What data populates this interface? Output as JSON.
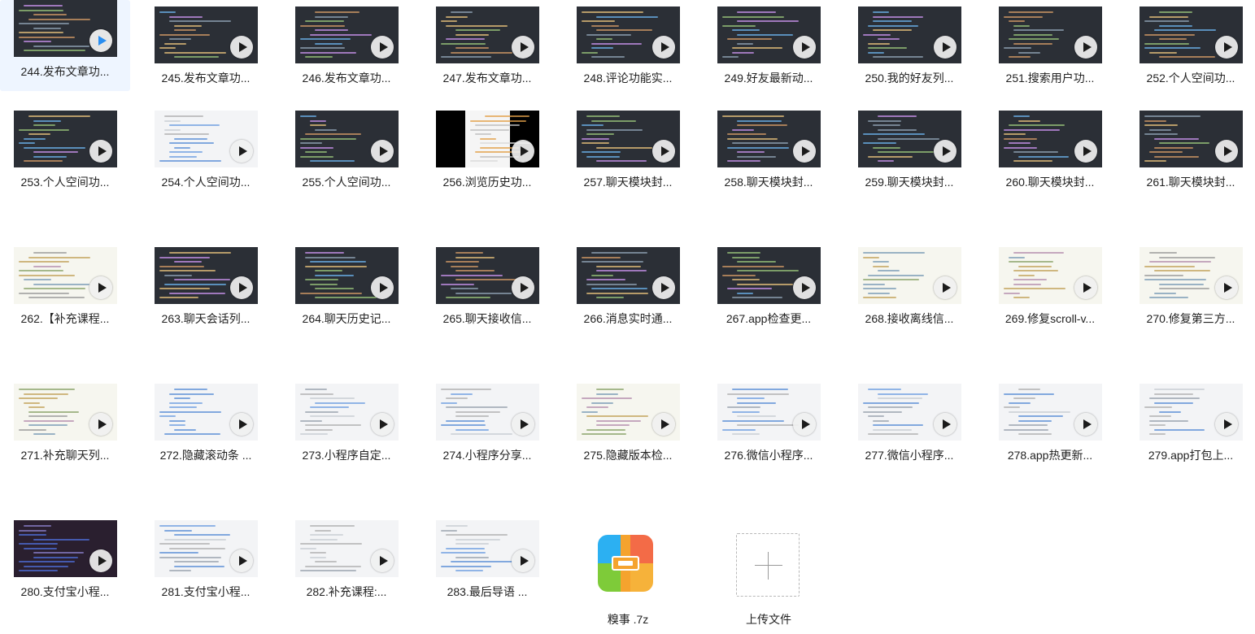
{
  "files": [
    {
      "name": "244.发布文章功...",
      "theme": "dark",
      "selected": true
    },
    {
      "name": "245.发布文章功...",
      "theme": "dark"
    },
    {
      "name": "246.发布文章功...",
      "theme": "dark"
    },
    {
      "name": "247.发布文章功...",
      "theme": "dark"
    },
    {
      "name": "248.评论功能实...",
      "theme": "dark"
    },
    {
      "name": "249.好友最新动...",
      "theme": "dark"
    },
    {
      "name": "250.我的好友列...",
      "theme": "dark"
    },
    {
      "name": "251.搜索用户功...",
      "theme": "dark"
    },
    {
      "name": "252.个人空间功...",
      "theme": "dark"
    },
    {
      "name": "253.个人空间功...",
      "theme": "dark"
    },
    {
      "name": "254.个人空间功...",
      "theme": "white"
    },
    {
      "name": "255.个人空间功...",
      "theme": "dark"
    },
    {
      "name": "256.浏览历史功...",
      "theme": "phone"
    },
    {
      "name": "257.聊天模块封...",
      "theme": "dark"
    },
    {
      "name": "258.聊天模块封...",
      "theme": "dark"
    },
    {
      "name": "259.聊天模块封...",
      "theme": "dark"
    },
    {
      "name": "260.聊天模块封...",
      "theme": "dark"
    },
    {
      "name": "261.聊天模块封...",
      "theme": "dark"
    },
    {
      "name": "262.【补充课程...",
      "theme": "light"
    },
    {
      "name": "263.聊天会话列...",
      "theme": "dark"
    },
    {
      "name": "264.聊天历史记...",
      "theme": "dark"
    },
    {
      "name": "265.聊天接收信...",
      "theme": "dark"
    },
    {
      "name": "266.消息实时通...",
      "theme": "dark"
    },
    {
      "name": "267.app检查更...",
      "theme": "dark"
    },
    {
      "name": "268.接收离线信...",
      "theme": "light"
    },
    {
      "name": "269.修复scroll-v...",
      "theme": "light"
    },
    {
      "name": "270.修复第三方...",
      "theme": "light"
    },
    {
      "name": "271.补充聊天列...",
      "theme": "light"
    },
    {
      "name": "272.隐藏滚动条 ...",
      "theme": "white"
    },
    {
      "name": "273.小程序自定...",
      "theme": "white"
    },
    {
      "name": "274.小程序分享...",
      "theme": "white"
    },
    {
      "name": "275.隐藏版本检...",
      "theme": "light"
    },
    {
      "name": "276.微信小程序...",
      "theme": "white"
    },
    {
      "name": "277.微信小程序...",
      "theme": "white"
    },
    {
      "name": "278.app热更新...",
      "theme": "white"
    },
    {
      "name": "279.app打包上...",
      "theme": "white"
    },
    {
      "name": "280.支付宝小程...",
      "theme": "brand"
    },
    {
      "name": "281.支付宝小程...",
      "theme": "white"
    },
    {
      "name": "282.补充课程:...",
      "theme": "white"
    },
    {
      "name": "283.最后导语 ...",
      "theme": "white"
    }
  ],
  "archive": {
    "name": "糗事 .7z",
    "icon": "archive-icon"
  },
  "upload": {
    "label": "上传文件",
    "icon": "plus-icon"
  }
}
